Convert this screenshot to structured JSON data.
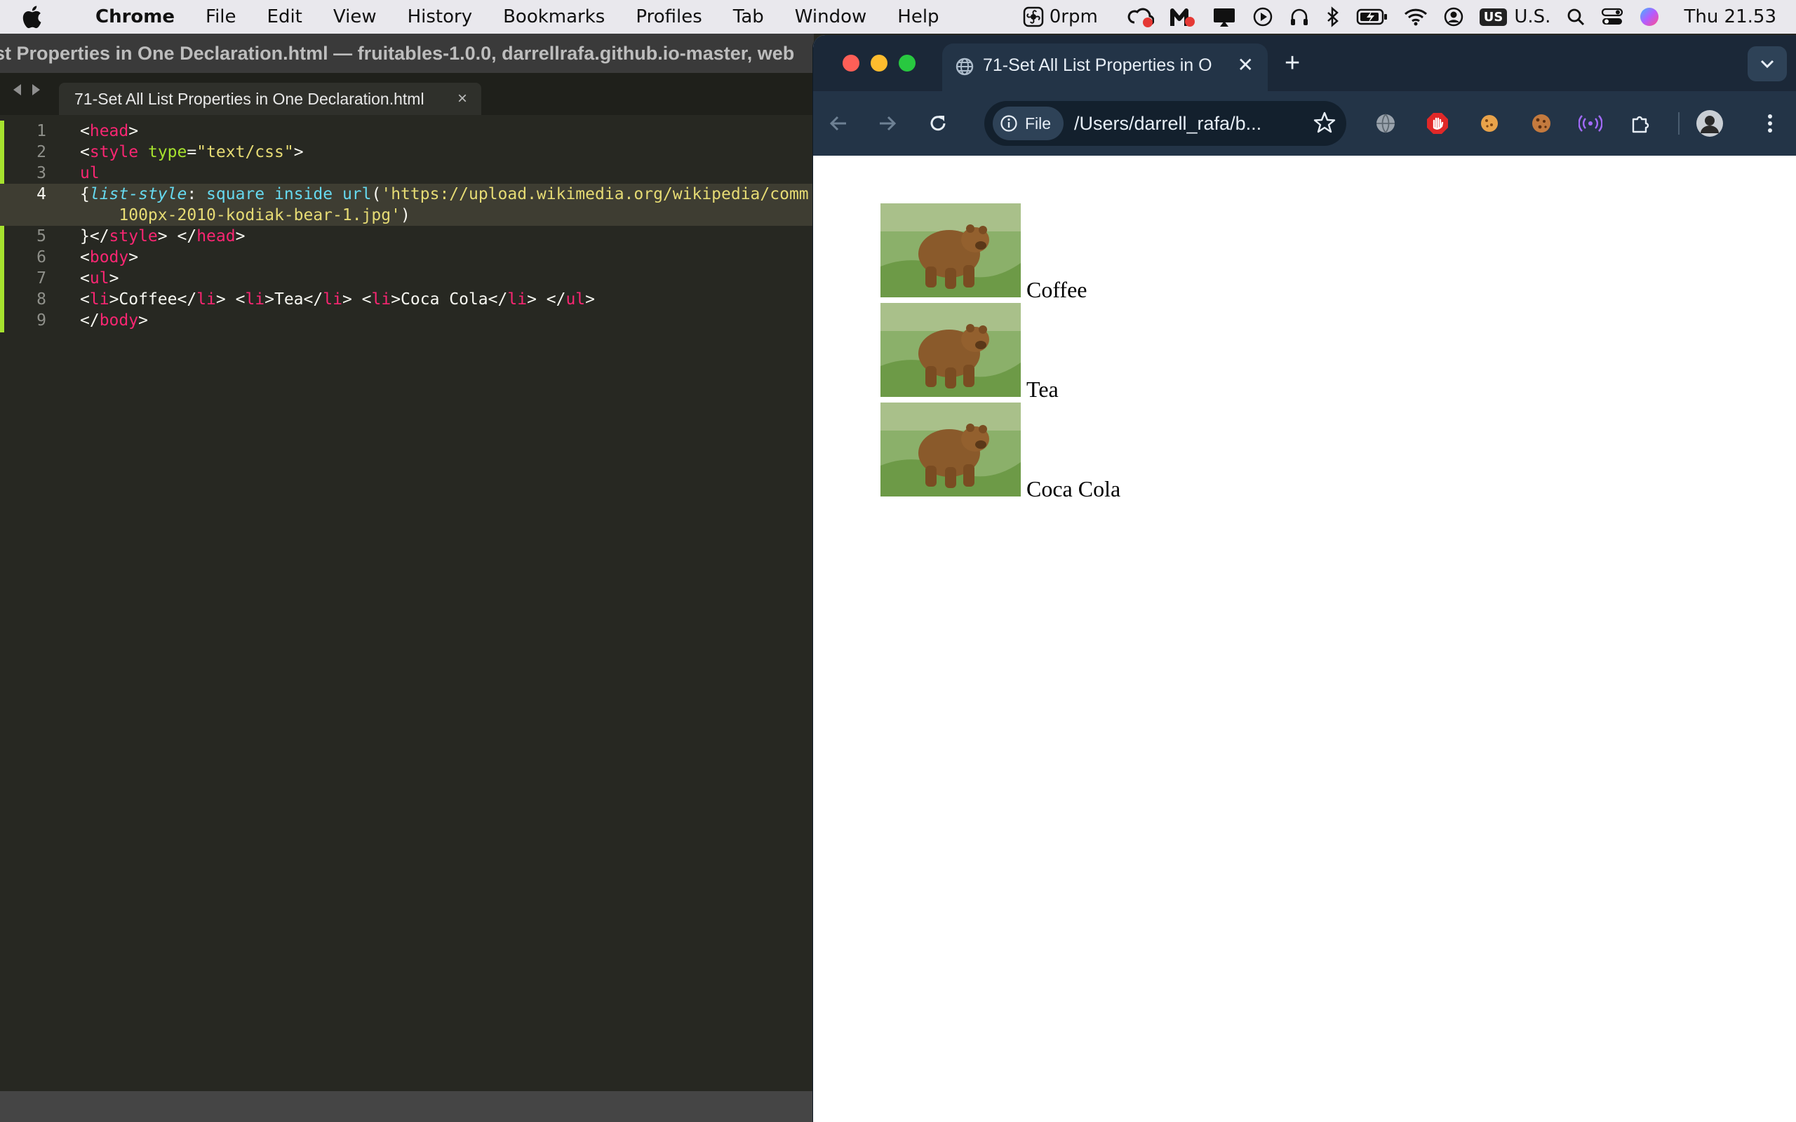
{
  "menubar": {
    "items": [
      "Chrome",
      "File",
      "Edit",
      "View",
      "History",
      "Bookmarks",
      "Profiles",
      "Tab",
      "Window",
      "Help"
    ],
    "status": {
      "rpm": "0rpm",
      "keyboard_badge": "US",
      "keyboard": "U.S.",
      "clock": "Thu  21.53"
    }
  },
  "editor": {
    "window_title": "st Properties in One Declaration.html — fruitables-1.0.0, darrellrafa.github.io-master, web",
    "tab_label": "71-Set All List Properties in One Declaration.html",
    "tab_close": "×",
    "lines": [
      {
        "n": "1"
      },
      {
        "n": "2"
      },
      {
        "n": "3"
      },
      {
        "n": "4"
      },
      {
        "n": "",
        "wrap": true
      },
      {
        "n": "5"
      },
      {
        "n": "6"
      },
      {
        "n": "7"
      },
      {
        "n": "8"
      },
      {
        "n": "9"
      }
    ]
  },
  "chrome": {
    "tab_title": "71-Set All List Properties in O",
    "tab_close": "✕",
    "new_tab": "+",
    "chip_label": "File",
    "url": "/Users/darrell_rafa/b...",
    "list_items": [
      "Coffee",
      "Tea",
      "Coca Cola"
    ]
  },
  "colors": {
    "editor_bg": "#272822",
    "tag": "#f92672",
    "attr": "#a6e22e",
    "string": "#e6db74",
    "keyword": "#66d9ef",
    "chrome_frame": "#1b2838",
    "chrome_toolbar": "#233447"
  }
}
